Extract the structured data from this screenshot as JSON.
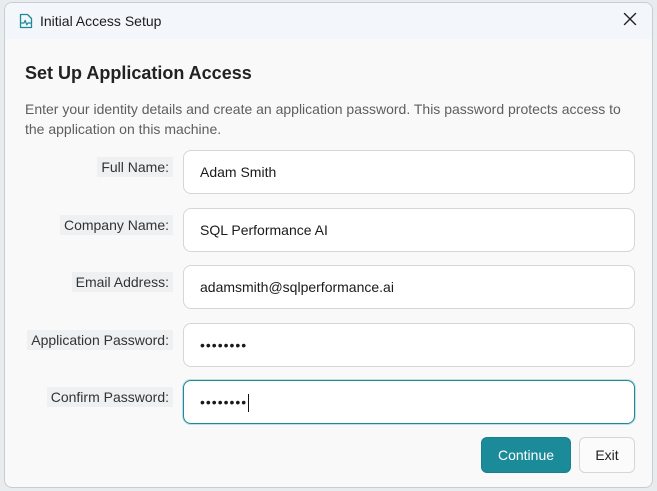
{
  "window": {
    "title": "Initial Access Setup"
  },
  "dialog": {
    "heading": "Set Up Application Access",
    "description": "Enter your identity details and create an application password. This password protects access to the application on this machine."
  },
  "form": {
    "full_name": {
      "label": "Full Name:",
      "value": "Adam Smith"
    },
    "company_name": {
      "label": "Company Name:",
      "value": "SQL Performance AI"
    },
    "email": {
      "label": "Email Address:",
      "value": "adamsmith@sqlperformance.ai"
    },
    "password": {
      "label": "Application Password:",
      "masked_value": "••••••••"
    },
    "confirm_password": {
      "label": "Confirm Password:",
      "masked_value": "••••••••"
    }
  },
  "buttons": {
    "continue_label": "Continue",
    "exit_label": "Exit"
  },
  "colors": {
    "accent": "#1b8a99",
    "title_bar": "#f3f6fb"
  },
  "icons": {
    "app": "activity-monitor-icon",
    "close": "close-icon"
  }
}
